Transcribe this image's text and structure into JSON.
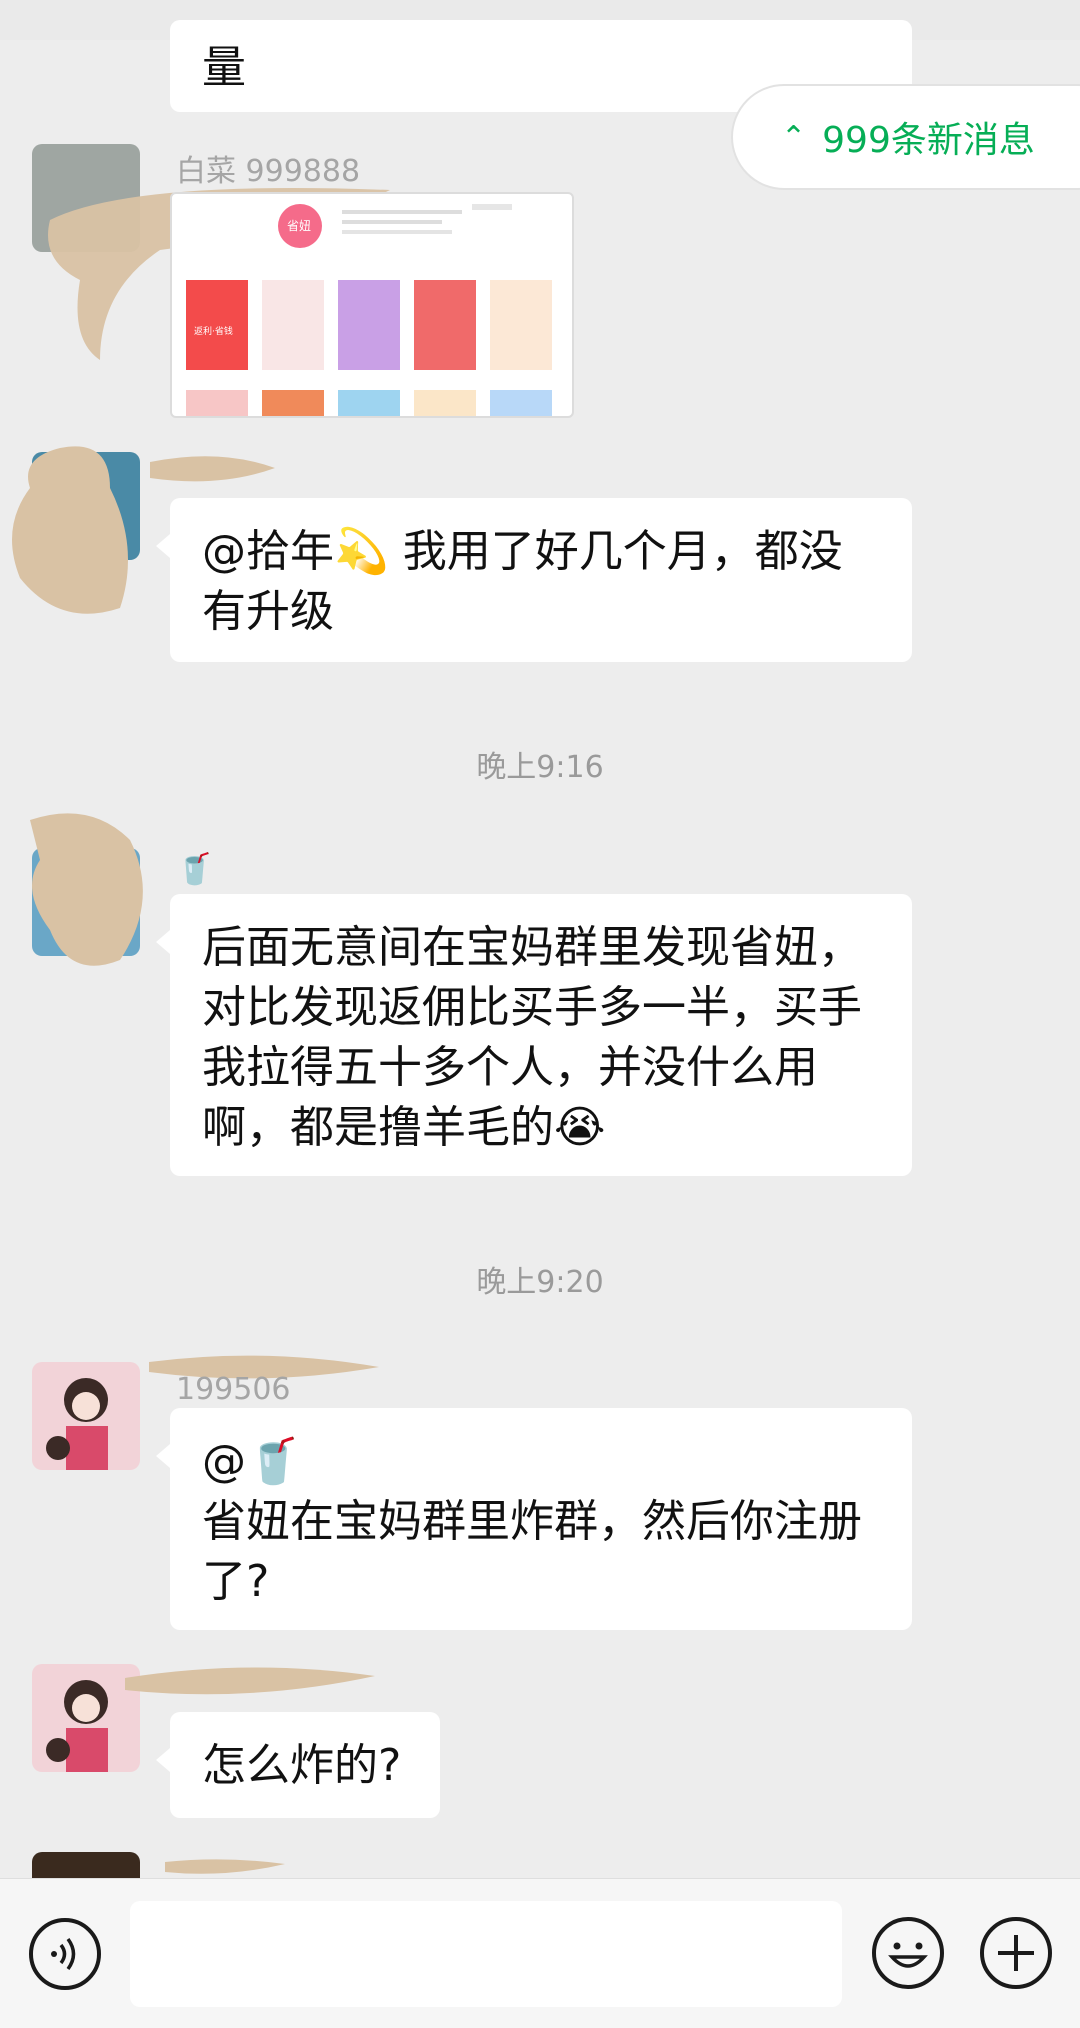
{
  "colors": {
    "accent": "#06ae56",
    "background": "#ededed",
    "bubble": "#ffffff",
    "time": "#9a9a9a"
  },
  "banner": {
    "label": "999条新消息",
    "icon": "double-chevron-up-icon"
  },
  "messages": [
    {
      "text": "量"
    },
    {
      "sender": "白菜 999888",
      "type": "image",
      "image_title": "省妞",
      "image_subtitle": "返利·省钱"
    },
    {
      "text": "@拾年💫 我用了好几个月，都没有升级"
    },
    {
      "time": "晚上9:16"
    },
    {
      "sender_emoji": "🥤",
      "text": "后面无意间在宝妈群里发现省妞，对比发现返佣比买手多一半，买手我拉得五十多个人，并没什么用啊，都是撸羊毛的😭"
    },
    {
      "time": "晚上9:20"
    },
    {
      "sender": "199506",
      "text_line1": "@🥤",
      "text_line2": "省妞在宝妈群里炸群，然后你注册了?"
    },
    {
      "text": "怎么炸的?"
    }
  ],
  "input_bar": {
    "voice_icon": "voice-icon",
    "emoji_icon": "emoji-icon",
    "plus_icon": "plus-icon",
    "value": ""
  }
}
